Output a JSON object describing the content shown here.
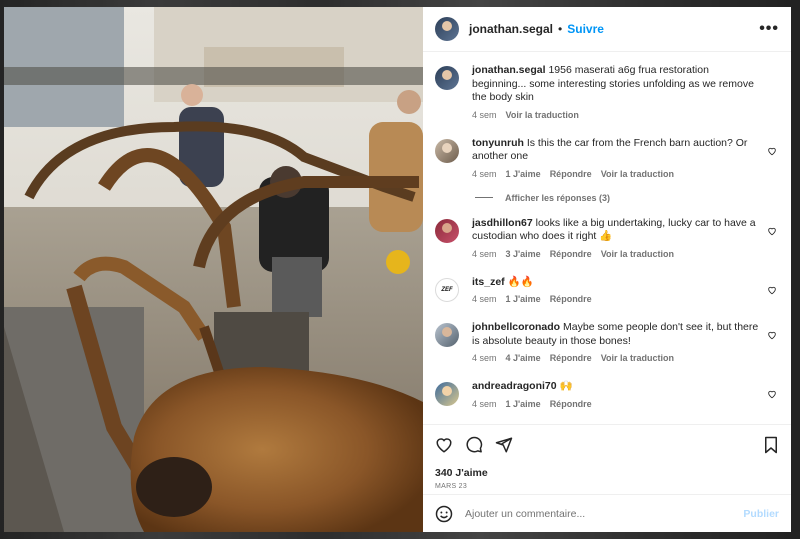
{
  "post": {
    "author": "jonathan.segal",
    "follow_label": "Suivre",
    "separator": "•",
    "more_label": "•••",
    "caption_user": "jonathan.segal",
    "caption_text": "1956 maserati a6g frua restoration beginning... some interesting stories unfolding as we remove the body skin",
    "caption_time": "4 sem",
    "caption_translate": "Voir la traduction",
    "likes": "340 J'aime",
    "date": "MARS 23"
  },
  "comments": [
    {
      "user": "tonyunruh",
      "text": "Is this the car from the French barn auction? Or another one",
      "time": "4 sem",
      "likes": "1 J'aime",
      "reply": "Répondre",
      "translate": "Voir la traduction"
    },
    {
      "user": "jasdhillon67",
      "text": "looks like a big undertaking, lucky car to have a custodian who does it right 👍",
      "time": "4 sem",
      "likes": "3 J'aime",
      "reply": "Répondre",
      "translate": "Voir la traduction"
    },
    {
      "user": "its_zef",
      "text": "🔥🔥",
      "time": "4 sem",
      "likes": "1 J'aime",
      "reply": "Répondre"
    },
    {
      "user": "johnbellcoronado",
      "text": "Maybe some people don't see it, but there is absolute beauty in those bones!",
      "time": "4 sem",
      "likes": "4 J'aime",
      "reply": "Répondre",
      "translate": "Voir la traduction"
    },
    {
      "user": "andreadragoni70",
      "text": "🙌",
      "time": "4 sem",
      "likes": "1 J'aime",
      "reply": "Répondre"
    }
  ],
  "replies_label": "Afficher les réponses (3)",
  "zef_logo": "ZEF",
  "add_comment": {
    "placeholder": "Ajouter un commentaire...",
    "publish": "Publier"
  },
  "icons": [
    "like-icon",
    "comment-icon",
    "share-icon",
    "save-icon",
    "emoji-icon",
    "more-icon"
  ],
  "colors": {
    "accent": "#0095f6",
    "publish_disabled": "#b3dbff",
    "secondary_text": "#737373"
  }
}
